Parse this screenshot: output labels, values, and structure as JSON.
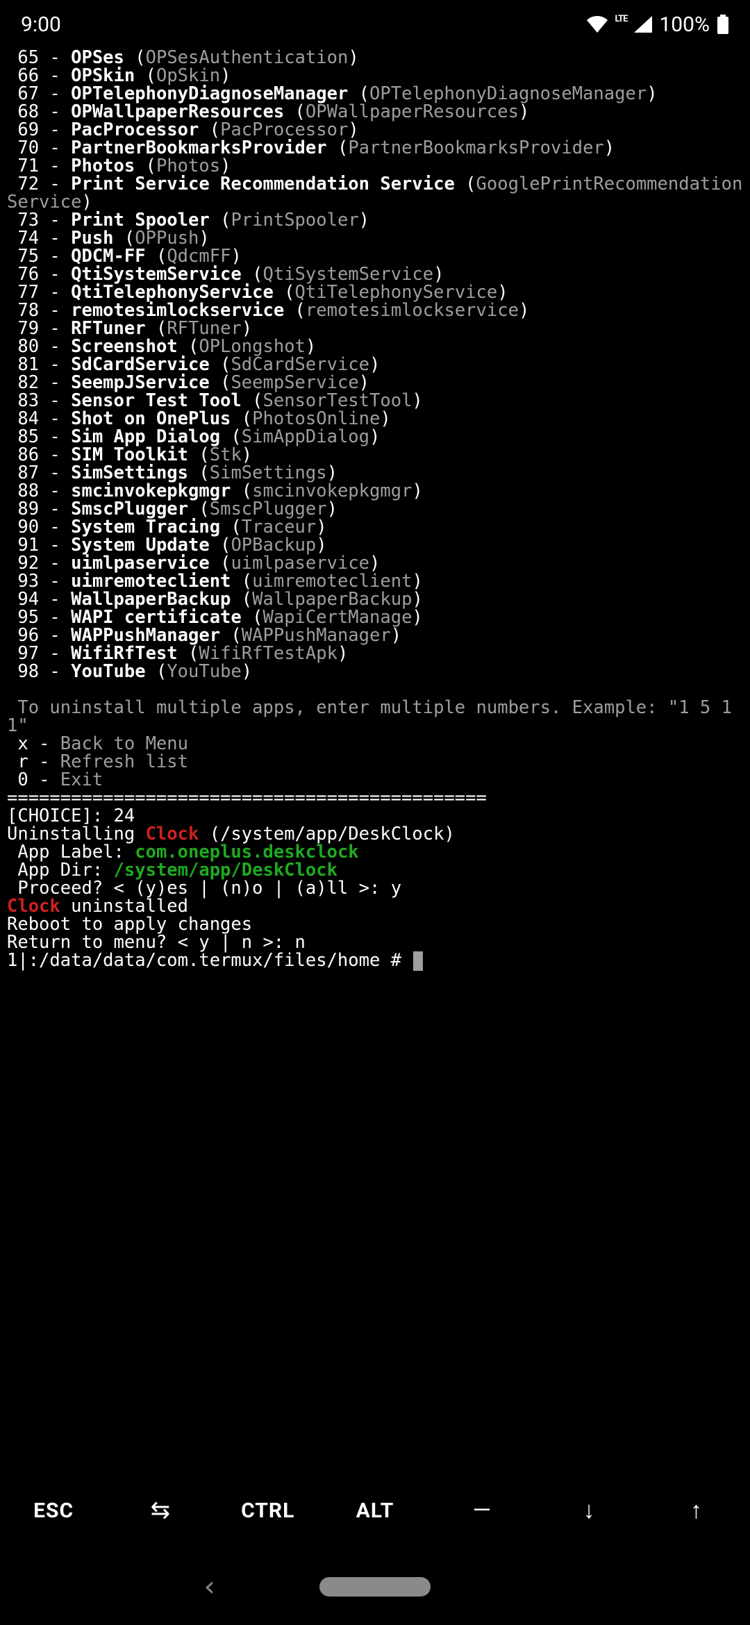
{
  "statusbar": {
    "time": "9:00",
    "battery": "100%"
  },
  "apps": [
    {
      "n": "65",
      "label": "OPSes",
      "pkg": "OPSesAuthentication"
    },
    {
      "n": "66",
      "label": "OPSkin",
      "pkg": "OpSkin"
    },
    {
      "n": "67",
      "label": "OPTelephonyDiagnoseManager",
      "pkg": "OPTelephonyDiagnoseManager"
    },
    {
      "n": "68",
      "label": "OPWallpaperResources",
      "pkg": "OPWallpaperResources"
    },
    {
      "n": "69",
      "label": "PacProcessor",
      "pkg": "PacProcessor"
    },
    {
      "n": "70",
      "label": "PartnerBookmarksProvider",
      "pkg": "PartnerBookmarksProvider"
    },
    {
      "n": "71",
      "label": "Photos",
      "pkg": "Photos"
    },
    {
      "n": "72",
      "label": "Print Service Recommendation Service",
      "pkg": "GooglePrintRecommendationService"
    },
    {
      "n": "73",
      "label": "Print Spooler",
      "pkg": "PrintSpooler"
    },
    {
      "n": "74",
      "label": "Push",
      "pkg": "OPPush"
    },
    {
      "n": "75",
      "label": "QDCM-FF",
      "pkg": "QdcmFF"
    },
    {
      "n": "76",
      "label": "QtiSystemService",
      "pkg": "QtiSystemService"
    },
    {
      "n": "77",
      "label": "QtiTelephonyService",
      "pkg": "QtiTelephonyService"
    },
    {
      "n": "78",
      "label": "remotesimlockservice",
      "pkg": "remotesimlockservice"
    },
    {
      "n": "79",
      "label": "RFTuner",
      "pkg": "RFTuner"
    },
    {
      "n": "80",
      "label": "Screenshot",
      "pkg": "OPLongshot"
    },
    {
      "n": "81",
      "label": "SdCardService",
      "pkg": "SdCardService"
    },
    {
      "n": "82",
      "label": "SeempJService",
      "pkg": "SeempService"
    },
    {
      "n": "83",
      "label": "Sensor Test Tool",
      "pkg": "SensorTestTool"
    },
    {
      "n": "84",
      "label": "Shot on OnePlus",
      "pkg": "PhotosOnline"
    },
    {
      "n": "85",
      "label": "Sim App Dialog",
      "pkg": "SimAppDialog"
    },
    {
      "n": "86",
      "label": "SIM Toolkit",
      "pkg": "Stk"
    },
    {
      "n": "87",
      "label": "SimSettings",
      "pkg": "SimSettings"
    },
    {
      "n": "88",
      "label": "smcinvokepkgmgr",
      "pkg": "smcinvokepkgmgr"
    },
    {
      "n": "89",
      "label": "SmscPlugger",
      "pkg": "SmscPlugger"
    },
    {
      "n": "90",
      "label": "System Tracing",
      "pkg": "Traceur"
    },
    {
      "n": "91",
      "label": "System Update",
      "pkg": "OPBackup"
    },
    {
      "n": "92",
      "label": "uimlpaservice",
      "pkg": "uimlpaservice"
    },
    {
      "n": "93",
      "label": "uimremoteclient",
      "pkg": "uimremoteclient"
    },
    {
      "n": "94",
      "label": "WallpaperBackup",
      "pkg": "WallpaperBackup"
    },
    {
      "n": "95",
      "label": "WAPI certificate",
      "pkg": "WapiCertManage"
    },
    {
      "n": "96",
      "label": "WAPPushManager",
      "pkg": "WAPPushManager"
    },
    {
      "n": "97",
      "label": "WifiRfTest",
      "pkg": "WifiRfTestApk"
    },
    {
      "n": "98",
      "label": "YouTube",
      "pkg": "YouTube"
    }
  ],
  "hint": " To uninstall multiple apps, enter multiple numbers. Example: \"1 5 11\"",
  "menu": {
    "x": " x - ",
    "x_label": "Back to Menu",
    "r": " r - ",
    "r_label": "Refresh list",
    "o": " 0 - ",
    "o_label": "Exit"
  },
  "divider": "=============================================",
  "choice_prompt": "[CHOICE]: ",
  "choice_val": "24",
  "uninst_prefix": "Uninstalling ",
  "uninst_app": "Clock",
  "uninst_path": " (/system/app/DeskClock)",
  "applabel_prefix": " App Label: ",
  "applabel_val": "com.oneplus.deskclock",
  "appdir_prefix": " App Dir: ",
  "appdir_val": "/system/app/DeskClock",
  "proceed": " Proceed? < (y)es | (n)o | (a)ll >: y",
  "done_app": "Clock",
  "done_suffix": " uninstalled",
  "reboot": "Reboot to apply changes",
  "return_prompt": "Return to menu? < y | n >: n",
  "prompt": "1|:/data/data/com.termux/files/home # ",
  "keys": {
    "esc": "ESC",
    "tab": "⇆",
    "ctrl": "CTRL",
    "alt": "ALT",
    "dash": "—",
    "down": "↓",
    "up": "↑"
  }
}
